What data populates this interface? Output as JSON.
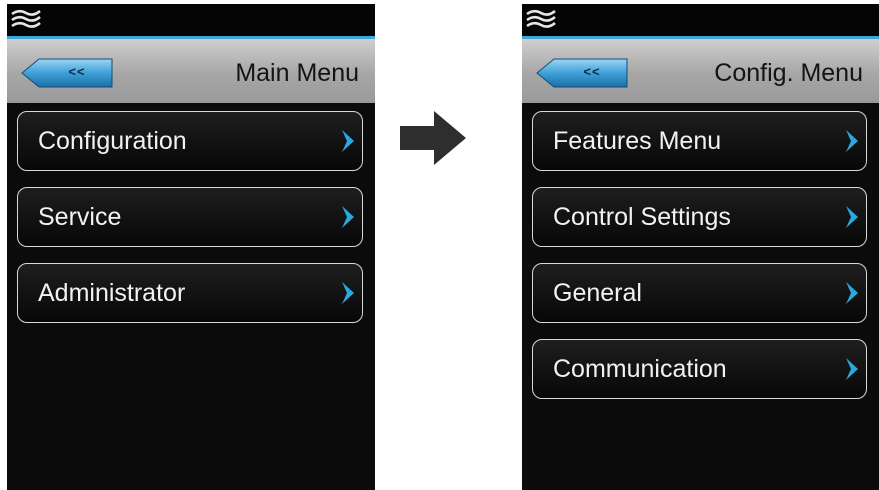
{
  "left_screen": {
    "logo_icon": "wave-logo-icon",
    "back_label": "<<",
    "title": "Main Menu",
    "items": [
      {
        "label": "Configuration",
        "icon": "chevron-right-icon"
      },
      {
        "label": "Service",
        "icon": "chevron-right-icon"
      },
      {
        "label": "Administrator",
        "icon": "chevron-right-icon"
      }
    ]
  },
  "transition_icon": "arrow-right-icon",
  "right_screen": {
    "logo_icon": "wave-logo-icon",
    "back_label": "<<",
    "title": "Config. Menu",
    "items": [
      {
        "label": "Features Menu",
        "icon": "chevron-right-icon"
      },
      {
        "label": "Control Settings",
        "icon": "chevron-right-icon"
      },
      {
        "label": "General",
        "icon": "chevron-right-icon"
      },
      {
        "label": "Communication",
        "icon": "chevron-right-icon"
      }
    ]
  },
  "colors": {
    "accent": "#3aa8d8",
    "screen_bg": "#0b0b0b",
    "header_bg": "#a6a6a6",
    "item_border": "#d9d9d9",
    "chevron": "#2aa7e0"
  }
}
